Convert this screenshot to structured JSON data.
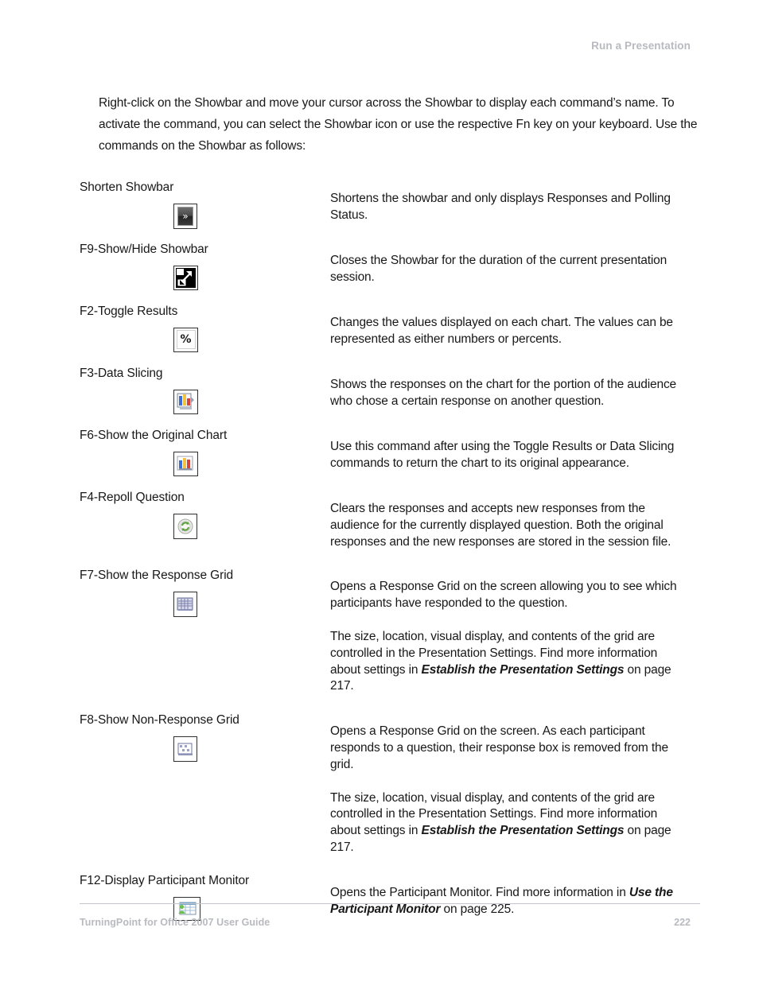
{
  "header": {
    "running_head": "Run a Presentation"
  },
  "intro": {
    "paragraph": "Right-click on the Showbar and move your cursor across the Showbar to display each command’s name. To activate the command, you can select the Showbar icon or use the respective Fn key on your keyboard. Use the commands on the Showbar as follows:"
  },
  "commands": [
    {
      "name": "Shorten Showbar",
      "icon": "double-chevron-right-icon",
      "descriptions": [
        {
          "text": "Shortens the showbar and only displays Responses and Polling Status."
        }
      ]
    },
    {
      "name": "F9-Show/Hide Showbar",
      "icon": "resize-diagonal-arrow-icon",
      "descriptions": [
        {
          "text": "Closes the Showbar for the duration of the current presentation session."
        }
      ]
    },
    {
      "name": "F2-Toggle Results",
      "icon": "percent-sign-icon",
      "descriptions": [
        {
          "text": "Changes the values displayed on each chart. The values can be represented as either numbers or percents."
        }
      ]
    },
    {
      "name": "F3-Data Slicing",
      "icon": "data-slicing-chart-icon",
      "descriptions": [
        {
          "text": "Shows the responses on the chart for the portion of the audience who chose a certain response on another question."
        }
      ]
    },
    {
      "name": "F6-Show the Original Chart",
      "icon": "bar-chart-icon",
      "descriptions": [
        {
          "text": "Use this command after using the Toggle Results or Data Slicing commands to return the chart to its original appearance."
        }
      ]
    },
    {
      "name": "F4-Repoll Question",
      "icon": "refresh-circle-icon",
      "descriptions": [
        {
          "text": "Clears the responses and accepts new responses from the audience for the currently displayed question. Both the original responses and the new responses are stored in the session file."
        }
      ]
    },
    {
      "name": "F7-Show the Response Grid",
      "icon": "response-grid-icon",
      "descriptions": [
        {
          "text": "Opens a Response Grid on the screen allowing you to see which participants have responded to the question."
        },
        {
          "pre": "The size, location, visual display, and contents of the grid are controlled in the Presentation Settings. Find more information about settings in ",
          "ref": "Establish the Presentation Settings",
          "post": " on page 217."
        }
      ]
    },
    {
      "name": "F8-Show Non-Response Grid",
      "icon": "non-response-grid-icon",
      "descriptions": [
        {
          "text": "Opens a Response Grid on the screen. As each participant responds to a question, their response box is removed from the grid."
        },
        {
          "pre": "The size, location, visual display, and contents of the grid are controlled in the Presentation Settings. Find more information about settings in ",
          "ref": "Establish the Presentation Settings",
          "post": " on page 217."
        }
      ]
    },
    {
      "name": "F12-Display Participant Monitor",
      "icon": "participant-monitor-icon",
      "descriptions": [
        {
          "pre": "Opens the Participant Monitor. Find more information in ",
          "ref": "Use the Participant Monitor",
          "post": " on page 225."
        }
      ]
    }
  ],
  "footer": {
    "guide_title": "TurningPoint for Office 2007 User Guide",
    "page_number": "222"
  },
  "colors": {
    "header_gray": "#b8bac0",
    "rule_gray": "#c3c5ca",
    "body_text": "#181818"
  }
}
